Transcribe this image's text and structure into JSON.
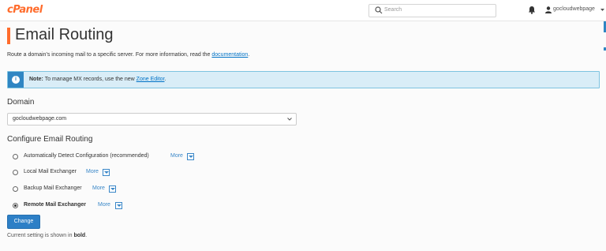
{
  "header": {
    "logo": "cPanel",
    "search_placeholder": "Search",
    "username": "gocloudwebpage"
  },
  "page": {
    "title": "Email Routing",
    "description": "Route a domain’s incoming mail to a specific server. For more information, read the ",
    "description_link": "documentation",
    "description_end": "."
  },
  "note": {
    "label": "Note:",
    "text": " To manage MX records, use the new ",
    "link": "Zone Editor",
    "end": "."
  },
  "domain": {
    "heading": "Domain",
    "selected": "gocloudwebpage.com"
  },
  "routing": {
    "heading": "Configure Email Routing",
    "more_label": "More",
    "options": [
      {
        "label": "Automatically Detect Configuration (recommended)",
        "checked": false
      },
      {
        "label": "Local Mail Exchanger",
        "checked": false
      },
      {
        "label": "Backup Mail Exchanger",
        "checked": false
      },
      {
        "label": "Remote Mail Exchanger",
        "checked": true
      }
    ]
  },
  "actions": {
    "change_label": "Change",
    "current_prefix": "Current setting is shown in ",
    "current_bold": "bold",
    "current_end": "."
  },
  "colors": {
    "brand": "#ff6c2c",
    "primary": "#2d7fc6",
    "info_bg": "#d9edf7"
  }
}
